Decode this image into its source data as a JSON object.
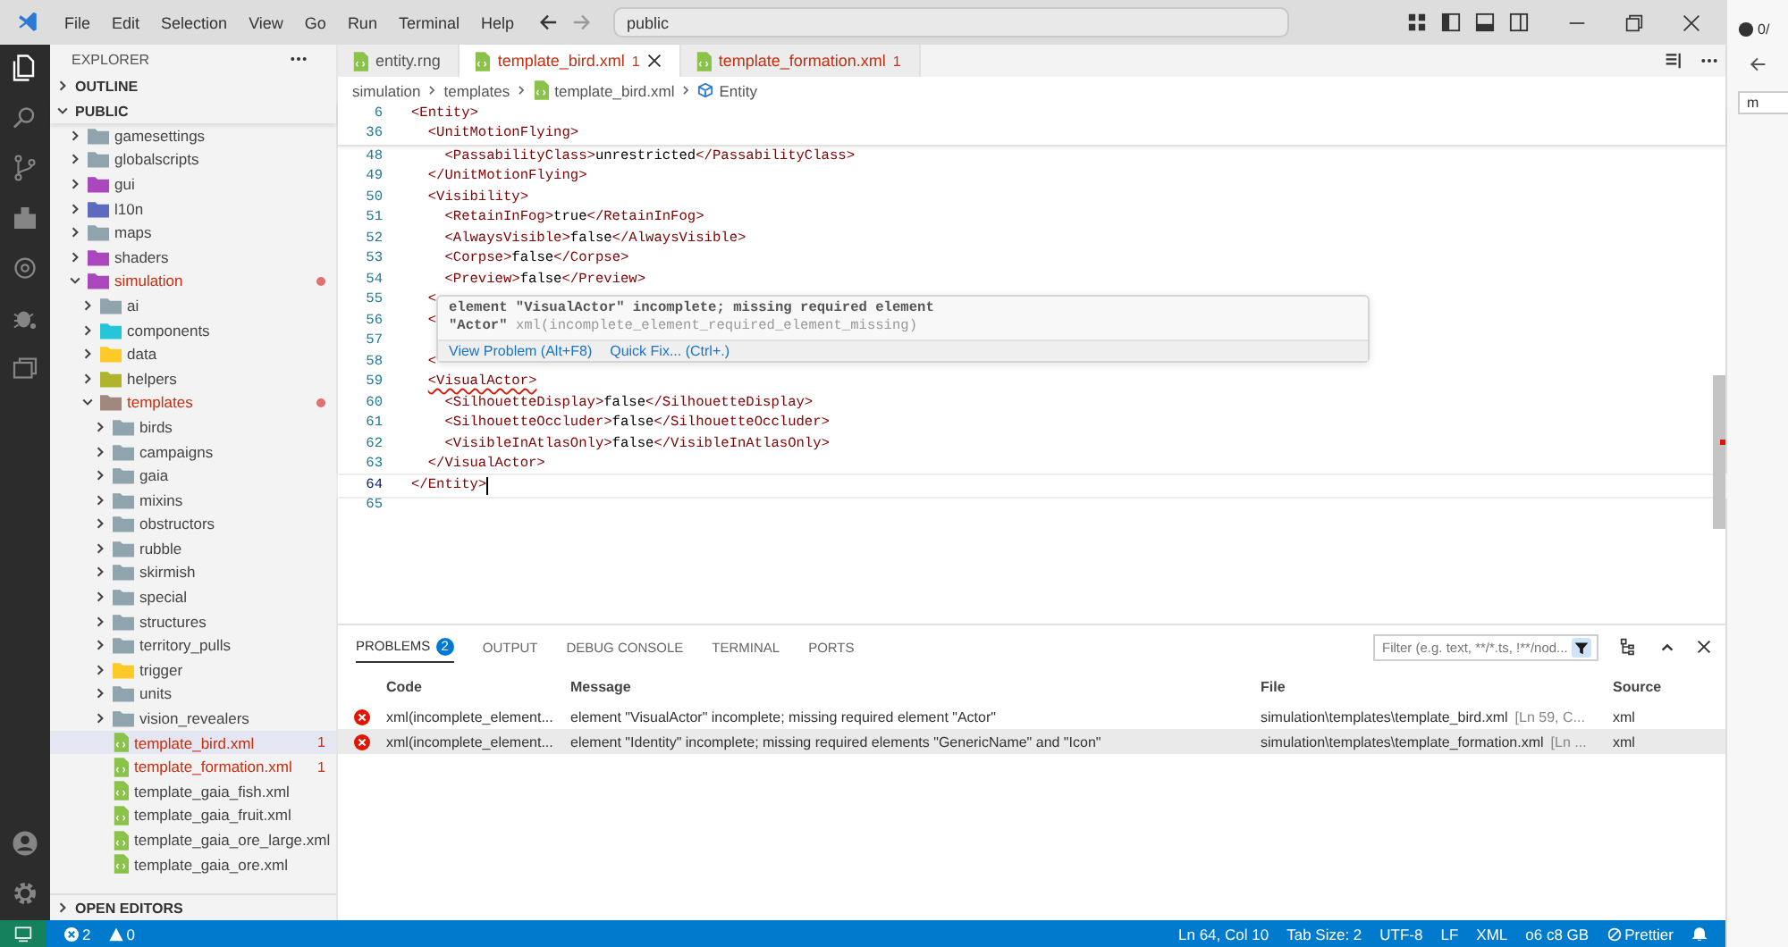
{
  "window": {
    "menu": [
      "File",
      "Edit",
      "Selection",
      "View",
      "Go",
      "Run",
      "Terminal",
      "Help"
    ],
    "search": "public"
  },
  "activity_bar": [
    {
      "kind": "explorer",
      "selected": true
    },
    {
      "kind": "search",
      "selected": false
    },
    {
      "kind": "source-control",
      "selected": false
    },
    {
      "kind": "extensions",
      "selected": false
    },
    {
      "kind": "remote",
      "selected": false
    },
    {
      "kind": "debug",
      "selected": false
    },
    {
      "kind": "windows",
      "selected": false
    }
  ],
  "sidebar": {
    "title": "EXPLORER",
    "outline": {
      "label": "OUTLINE",
      "expanded": false
    },
    "root": {
      "label": "PUBLIC",
      "expanded": true,
      "items": [
        {
          "label": "gamesettings",
          "kind": "folder",
          "color": "#90a4ae",
          "expanded": false,
          "selected": false,
          "error": false
        },
        {
          "label": "globalscripts",
          "kind": "folder",
          "color": "#90a4ae",
          "expanded": false,
          "selected": false,
          "error": false
        },
        {
          "label": "gui",
          "kind": "folder",
          "color": "#ab47bc",
          "expanded": false,
          "selected": false,
          "error": false
        },
        {
          "label": "l10n",
          "kind": "folder",
          "color": "#5c6bc0",
          "expanded": false,
          "selected": false,
          "error": false
        },
        {
          "label": "maps",
          "kind": "folder",
          "color": "#90a4ae",
          "expanded": false,
          "selected": false,
          "error": false
        },
        {
          "label": "shaders",
          "kind": "folder",
          "color": "#ab47bc",
          "expanded": false,
          "selected": false,
          "error": false
        },
        {
          "label": "simulation",
          "kind": "folder",
          "color": "#ab47bc",
          "expanded": true,
          "selected": false,
          "error": true,
          "children": [
            {
              "label": "ai",
              "kind": "folder",
              "color": "#90a4ae",
              "expanded": false,
              "selected": false,
              "error": false
            },
            {
              "label": "components",
              "kind": "folder",
              "color": "#26c6da",
              "expanded": false,
              "selected": false,
              "error": false
            },
            {
              "label": "data",
              "kind": "folder",
              "color": "#ffca28",
              "expanded": false,
              "selected": false,
              "error": false
            },
            {
              "label": "helpers",
              "kind": "folder",
              "color": "#afb42b",
              "expanded": false,
              "selected": false,
              "error": false
            },
            {
              "label": "templates",
              "kind": "folder",
              "color": "#a1887f",
              "expanded": true,
              "selected": false,
              "error": true,
              "children": [
                {
                  "label": "birds",
                  "kind": "folder",
                  "color": "#90a4ae",
                  "expanded": false,
                  "selected": false,
                  "error": false
                },
                {
                  "label": "campaigns",
                  "kind": "folder",
                  "color": "#90a4ae",
                  "expanded": false,
                  "selected": false,
                  "error": false
                },
                {
                  "label": "gaia",
                  "kind": "folder",
                  "color": "#90a4ae",
                  "expanded": false,
                  "selected": false,
                  "error": false
                },
                {
                  "label": "mixins",
                  "kind": "folder",
                  "color": "#90a4ae",
                  "expanded": false,
                  "selected": false,
                  "error": false
                },
                {
                  "label": "obstructors",
                  "kind": "folder",
                  "color": "#90a4ae",
                  "expanded": false,
                  "selected": false,
                  "error": false
                },
                {
                  "label": "rubble",
                  "kind": "folder",
                  "color": "#90a4ae",
                  "expanded": false,
                  "selected": false,
                  "error": false
                },
                {
                  "label": "skirmish",
                  "kind": "folder",
                  "color": "#90a4ae",
                  "expanded": false,
                  "selected": false,
                  "error": false
                },
                {
                  "label": "special",
                  "kind": "folder",
                  "color": "#90a4ae",
                  "expanded": false,
                  "selected": false,
                  "error": false
                },
                {
                  "label": "structures",
                  "kind": "folder",
                  "color": "#90a4ae",
                  "expanded": false,
                  "selected": false,
                  "error": false
                },
                {
                  "label": "territory_pulls",
                  "kind": "folder",
                  "color": "#90a4ae",
                  "expanded": false,
                  "selected": false,
                  "error": false
                },
                {
                  "label": "trigger",
                  "kind": "folder",
                  "color": "#ffca28",
                  "expanded": false,
                  "selected": false,
                  "error": false
                },
                {
                  "label": "units",
                  "kind": "folder",
                  "color": "#90a4ae",
                  "expanded": false,
                  "selected": false,
                  "error": false
                },
                {
                  "label": "vision_revealers",
                  "kind": "folder",
                  "color": "#90a4ae",
                  "expanded": false,
                  "selected": false,
                  "error": false
                },
                {
                  "label": "template_bird.xml",
                  "kind": "file",
                  "badge": "1",
                  "selected": true,
                  "error": true
                },
                {
                  "label": "template_formation.xml",
                  "kind": "file",
                  "badge": "1",
                  "selected": false,
                  "error": true
                },
                {
                  "label": "template_gaia_fish.xml",
                  "kind": "file",
                  "selected": false,
                  "error": false
                },
                {
                  "label": "template_gaia_fruit.xml",
                  "kind": "file",
                  "selected": false,
                  "error": false
                },
                {
                  "label": "template_gaia_ore_large.xml",
                  "kind": "file",
                  "selected": false,
                  "error": false
                },
                {
                  "label": "template_gaia_ore.xml",
                  "kind": "file",
                  "selected": false,
                  "error": false
                }
              ]
            }
          ]
        }
      ]
    },
    "open_editors": {
      "label": "OPEN EDITORS",
      "expanded": false
    }
  },
  "tabs": [
    {
      "label": "entity.rng",
      "selected": false,
      "error": false
    },
    {
      "label": "template_bird.xml",
      "badge": "1",
      "selected": true,
      "error": true
    },
    {
      "label": "template_formation.xml",
      "badge": "1",
      "selected": false,
      "error": true
    }
  ],
  "breadcrumb": [
    "simulation",
    "templates",
    "template_bird.xml",
    "Entity"
  ],
  "lines": [
    {
      "num": "6",
      "text": "<Entity>",
      "sticky": true
    },
    {
      "num": "36",
      "text": "  <UnitMotionFlying>",
      "sticky": true
    },
    {
      "num": "48",
      "text": "    <PassabilityClass>unrestricted</PassabilityClass>"
    },
    {
      "num": "49",
      "text": "  </UnitMotionFlying>"
    },
    {
      "num": "50",
      "text": "  <Visibility>"
    },
    {
      "num": "51",
      "text": "    <RetainInFog>true</RetainInFog>"
    },
    {
      "num": "52",
      "text": "    <AlwaysVisible>false</AlwaysVisible>"
    },
    {
      "num": "53",
      "text": "    <Corpse>false</Corpse>"
    },
    {
      "num": "54",
      "text": "    <Preview>false</Preview>"
    },
    {
      "num": "55",
      "text": "  <"
    },
    {
      "num": "56",
      "text": "  <"
    },
    {
      "num": "57"
    },
    {
      "num": "58",
      "text": "  <"
    },
    {
      "num": "59",
      "text": "  <VisualActor>",
      "squiggle": true
    },
    {
      "num": "60",
      "text": "    <SilhouetteDisplay>false</SilhouetteDisplay>"
    },
    {
      "num": "61",
      "text": "    <SilhouetteOccluder>false</SilhouetteOccluder>"
    },
    {
      "num": "62",
      "text": "    <VisibleInAtlasOnly>false</VisibleInAtlasOnly>"
    },
    {
      "num": "63",
      "text": "  </VisualActor>"
    },
    {
      "num": "64",
      "text": "</Entity>",
      "current": true
    },
    {
      "num": "65"
    }
  ],
  "hover": {
    "message": "element \"VisualActor\" incomplete; missing required element \"Actor\"",
    "source": "xml(incomplete_element_required_element_missing)",
    "actions": [
      "View Problem (Alt+F8)",
      "Quick Fix... (Ctrl+.)"
    ]
  },
  "panel": {
    "tabs": [
      {
        "label": "PROBLEMS",
        "badge": "2",
        "selected": true
      },
      {
        "label": "OUTPUT",
        "selected": false
      },
      {
        "label": "DEBUG CONSOLE",
        "selected": false
      },
      {
        "label": "TERMINAL",
        "selected": false
      },
      {
        "label": "PORTS",
        "selected": false
      }
    ],
    "filter": {
      "placeholder": "Filter (e.g. text, **/*.ts, !**/nod..."
    },
    "columns": [
      "Code",
      "Message",
      "File",
      "Source"
    ],
    "rows": [
      {
        "code": "xml(incomplete_element...",
        "message": "element \"VisualActor\" incomplete; missing required element \"Actor\"",
        "file": "simulation\\templates\\template_bird.xml",
        "location": "[Ln 59, C...",
        "source": "xml",
        "selected": false
      },
      {
        "code": "xml(incomplete_element...",
        "message": "element \"Identity\" incomplete; missing required elements \"GenericName\" and \"Icon\"",
        "file": "simulation\\templates\\template_formation.xml",
        "location": "[Ln ...",
        "source": "xml",
        "selected": true
      }
    ]
  },
  "status_bar": {
    "errors": "2",
    "warnings": "0",
    "items": [
      {
        "text": "Ln 64, Col 10",
        "kind": "text"
      },
      {
        "text": "Tab Size: 2",
        "kind": "text"
      },
      {
        "text": "UTF-8",
        "kind": "text"
      },
      {
        "text": "LF",
        "kind": "text"
      },
      {
        "text": "XML",
        "kind": "text"
      },
      {
        "text": "o6 c8 GB",
        "kind": "text"
      },
      {
        "text": "Prettier",
        "kind": "prettier"
      }
    ]
  },
  "side_window": {
    "count": "0/",
    "tab": "m"
  }
}
